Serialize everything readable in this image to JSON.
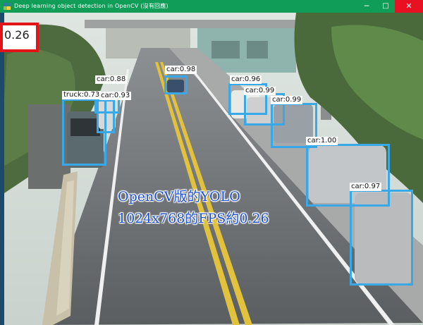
{
  "window": {
    "title": "Deep learning object detection in OpenCV (沒有回應)",
    "app_icon": "python-icon",
    "controls": {
      "minimize": "─",
      "maximize": "□",
      "close": "✕"
    }
  },
  "fps_display": "0.26",
  "detections": [
    {
      "label": "car:0.98"
    },
    {
      "label": "car:0.88"
    },
    {
      "label": "truck:0.73"
    },
    {
      "label": "car:0.93"
    },
    {
      "label": "car:0.96"
    },
    {
      "label": "car:0.99"
    },
    {
      "label": "car:0.99"
    },
    {
      "label": "car:1.00"
    },
    {
      "label": "car:0.97"
    }
  ],
  "overlay_text": {
    "line1": "OpenCV版的YOLO",
    "line2": "1024x768的FPS約0.26"
  },
  "colors": {
    "titlebar": "#0f9d58",
    "detection_box": "#39a8e8",
    "fps_box": "#e2141a",
    "overlay_text": "#1d4fd1"
  }
}
